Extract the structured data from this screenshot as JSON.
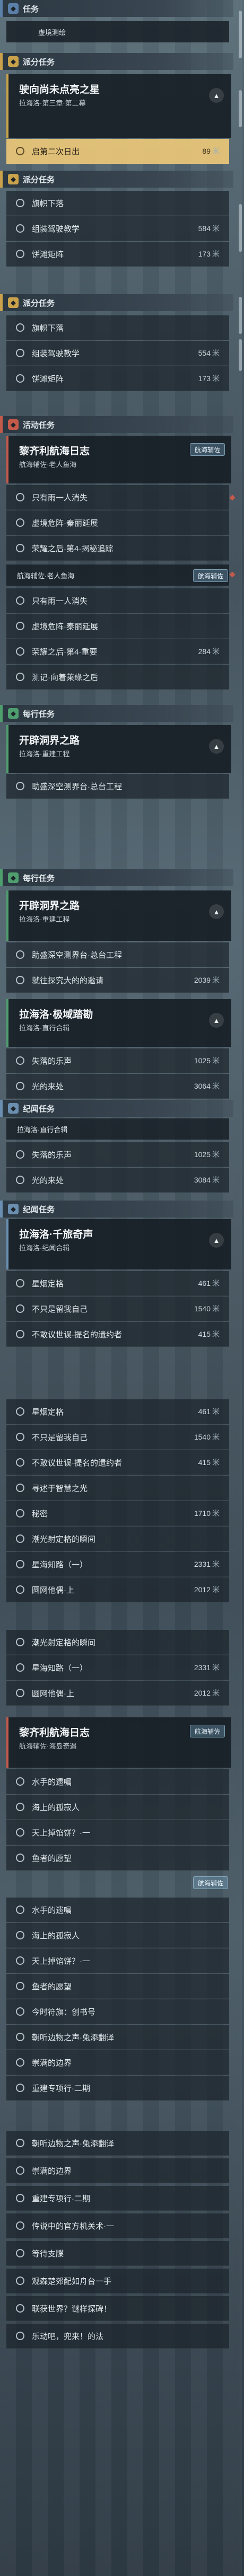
{
  "colors": {
    "main": "#5a7fa8",
    "branch": "#c9a24b",
    "event": "#c45a4a",
    "daily": "#4f9e6e",
    "kiyoshi": "#6a8fb0",
    "accent": "#ecc878"
  },
  "units": {
    "m": "米"
  },
  "sections": {
    "main": "任务",
    "branch1": "派分任务",
    "branch2": "派分任务",
    "branch3": "派分任务",
    "event": "活动任务",
    "daily1": "每行任务",
    "daily2": "每行任务",
    "kiyoshi1": "纪闻任务",
    "kiyoshi2": "纪闻任务"
  },
  "main_sub": "虚境测绘",
  "card1": {
    "title": "驶向尚未点亮之星",
    "subtitle": "拉海洛·第三章·第二幕"
  },
  "hl_row": {
    "label": "启第二次日出",
    "dist": "89"
  },
  "branch_rows": [
    {
      "label": "旗帜下落",
      "dist": ""
    },
    {
      "label": "组装驾驶教学",
      "dist": "584"
    },
    {
      "label": "饼滩矩阵",
      "dist": "173"
    }
  ],
  "branch_rows2": [
    {
      "label": "旗帜下落",
      "dist": ""
    },
    {
      "label": "组装驾驶教学",
      "dist": "554"
    },
    {
      "label": "饼滩矩阵",
      "dist": "173"
    }
  ],
  "event_card": {
    "title": "黎齐利航海日志",
    "subtitle": "航海辅佐·老人鱼海",
    "badge": "航海辅佐"
  },
  "event_rows": [
    {
      "label": "只有雨一人消失",
      "dist": ""
    },
    {
      "label": "虚境危阵·秦丽延展",
      "dist": ""
    },
    {
      "label": "荣耀之后·第4·揭秘追踪",
      "dist": ""
    }
  ],
  "event_mini": "航海辅佐·老人鱼海",
  "event_badge2": "航海辅佐",
  "event_rows2": [
    {
      "label": "只有雨一人消失",
      "dist": ""
    },
    {
      "label": "虚境危阵·秦丽延展",
      "dist": ""
    },
    {
      "label": "荣耀之后·第4·重要",
      "dist": "284"
    },
    {
      "label": "测记·向着莱缘之后",
      "dist": ""
    }
  ],
  "daily_card1": {
    "title": "开辟洞界之路",
    "subtitle": "拉海洛·重建工程"
  },
  "daily_row1": "助盛深空测界台·总台工程",
  "daily_card2": {
    "title": "开辟洞界之路",
    "subtitle": "拉海洛·重建工程"
  },
  "daily_rows2": [
    {
      "label": "助盛深空测界台·总台工程",
      "dist": ""
    },
    {
      "label": "就往探究大的的邀请",
      "dist": "2039"
    }
  ],
  "daily_card3": {
    "title": "拉海洛·极域踏勘",
    "subtitle": "拉海洛·直行合辑"
  },
  "daily_rows3": [
    {
      "label": "失落的乐声",
      "dist": "1025"
    },
    {
      "label": "光的来处",
      "dist": "3064"
    }
  ],
  "kiyoshi_mini": "拉海洛·直行合辑",
  "kiyoshi_rows": [
    {
      "label": "失落的乐声",
      "dist": "1025"
    },
    {
      "label": "光的来处",
      "dist": "3084"
    }
  ],
  "kiyoshi_card": {
    "title": "拉海洛·千旅奇声",
    "subtitle": "拉海洛·纪闻合辑"
  },
  "kiyoshi_rows2": [
    {
      "label": "星烟定格",
      "dist": "461"
    },
    {
      "label": "不只是留我自己",
      "dist": "1540"
    },
    {
      "label": "不敢议世误·提名的遗约者",
      "dist": "415"
    }
  ],
  "long_rows": [
    {
      "label": "星烟定格",
      "dist": "461"
    },
    {
      "label": "不只是留我自己",
      "dist": "1540"
    },
    {
      "label": "不敢议世误·提名的遗约者",
      "dist": "415"
    },
    {
      "label": "寻述于智慧之光",
      "dist": ""
    },
    {
      "label": "秘密",
      "dist": "1710"
    },
    {
      "label": "潮光射定格的瞬间",
      "dist": ""
    },
    {
      "label": "星海知路（一）",
      "dist": "2331"
    },
    {
      "label": "圆网他偶·上",
      "dist": "2012"
    }
  ],
  "long_rows2": [
    {
      "label": "潮光射定格的瞬间",
      "dist": ""
    },
    {
      "label": "星海知路（一）",
      "dist": "2331"
    },
    {
      "label": "圆网他偶·上",
      "dist": "2012"
    }
  ],
  "log_card": {
    "title": "黎齐利航海日志",
    "subtitle": "航海辅佐·海岛奇遇",
    "badge": "航海辅佐"
  },
  "log_rows": [
    {
      "label": "水手的遗嘱",
      "dist": ""
    },
    {
      "label": "海上的孤寂人",
      "dist": ""
    },
    {
      "label": "天上掉馅饼？·一",
      "dist": ""
    },
    {
      "label": "鱼者的愿望",
      "dist": ""
    }
  ],
  "log_badge2": "航海辅佐",
  "log_rows2": [
    {
      "label": "水手的遗嘱",
      "dist": ""
    },
    {
      "label": "海上的孤寂人",
      "dist": ""
    },
    {
      "label": "天上掉馅饼？·一",
      "dist": ""
    },
    {
      "label": "鱼者的愿望",
      "dist": ""
    },
    {
      "label": "今时符旗：创书号",
      "dist": ""
    },
    {
      "label": "朝听边物之声·兔添翻译",
      "dist": ""
    },
    {
      "label": "崇满的边界",
      "dist": ""
    },
    {
      "label": "重建专项行·二期",
      "dist": ""
    }
  ],
  "end_rows": [
    {
      "label": "朝听边物之声·兔添翻译",
      "dist": ""
    },
    {
      "label": "崇满的边界",
      "dist": ""
    },
    {
      "label": "重建专项行·二期",
      "dist": ""
    },
    {
      "label": "传说中的官方机关术·一",
      "dist": ""
    },
    {
      "label": "等待支牒",
      "dist": ""
    },
    {
      "label": "观森楚郊配如舟台一手",
      "dist": ""
    },
    {
      "label": "联获世界？谜样探碑！",
      "dist": ""
    },
    {
      "label": "乐动吧，兜来！的法",
      "dist": ""
    }
  ]
}
